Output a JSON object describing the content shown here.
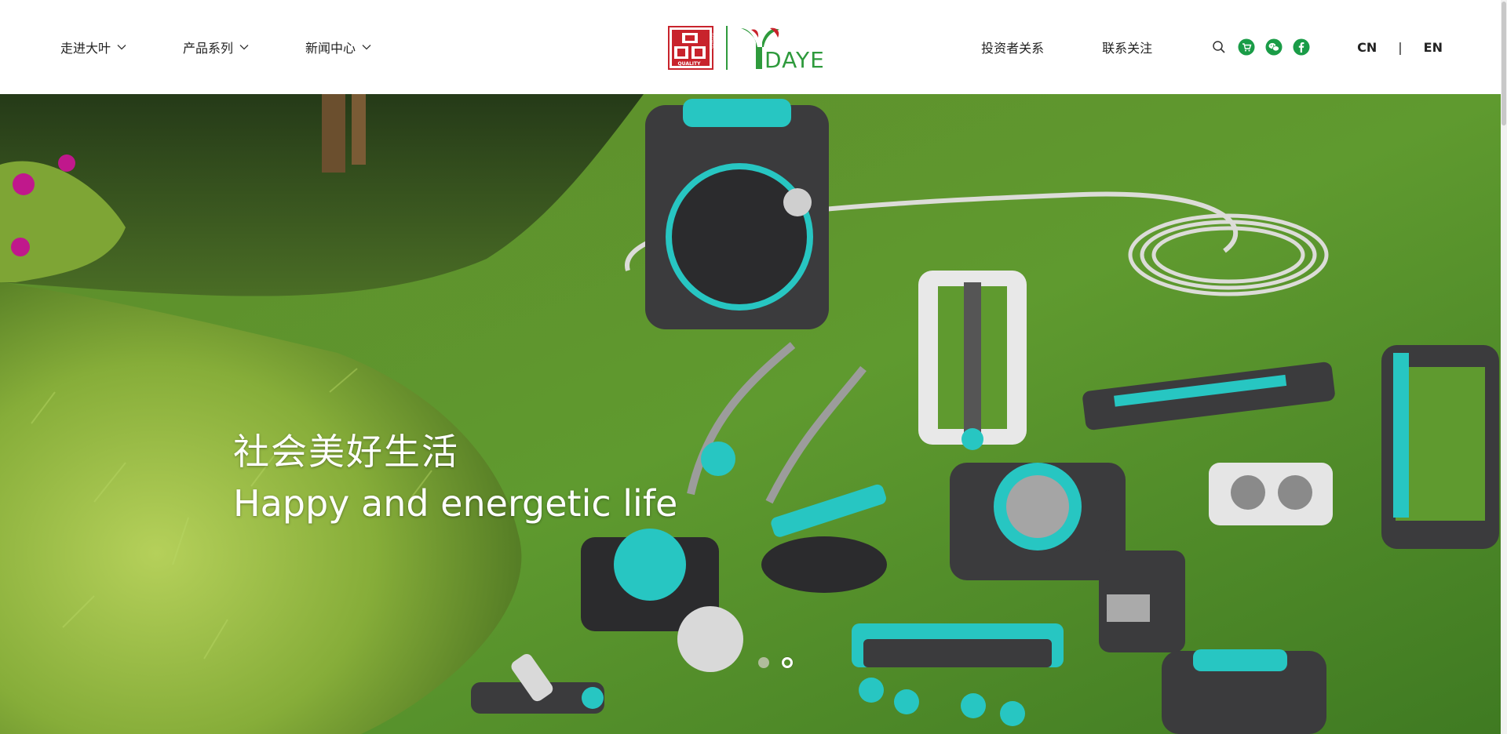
{
  "nav": {
    "left": [
      {
        "label": "走进大叶"
      },
      {
        "label": "产品系列"
      },
      {
        "label": "新闻中心"
      }
    ],
    "right": [
      {
        "label": "投资者关系"
      },
      {
        "label": "联系关注"
      }
    ],
    "icons": [
      "search-icon",
      "shop-icon",
      "wechat-icon",
      "facebook-icon"
    ],
    "lang": {
      "cn": "CN",
      "sep": "|",
      "en": "EN"
    }
  },
  "logo": {
    "seal_text": "QUALITY",
    "seal_side_text": "DEFINED",
    "brand": "DAYE"
  },
  "hero": {
    "title_cn": "社会美好生活",
    "title_en": "Happy and energetic life",
    "slides_count": 2,
    "active_slide": 2
  },
  "colors": {
    "brand_green": "#2e9a3c",
    "brand_red": "#c8232c",
    "icon_green": "#1a9c47",
    "teal": "#27c6c2"
  }
}
